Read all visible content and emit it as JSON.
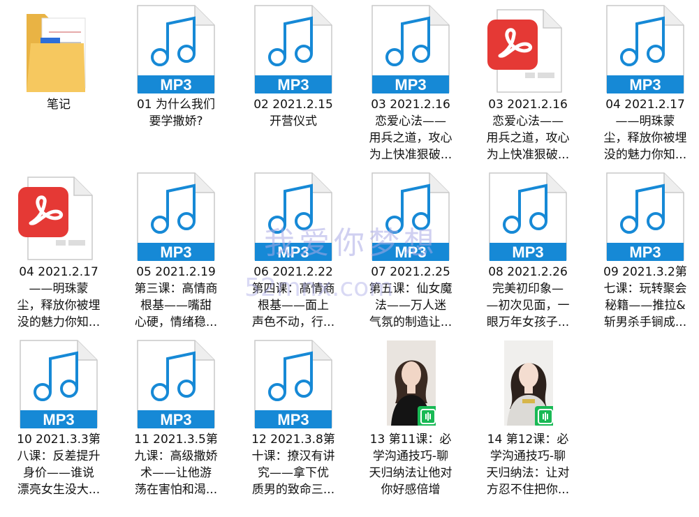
{
  "items": [
    {
      "type": "folder",
      "label": "笔记"
    },
    {
      "type": "mp3",
      "label": "01 为什么我们\n要学撒娇?"
    },
    {
      "type": "mp3",
      "label": "02 2021.2.15\n开营仪式"
    },
    {
      "type": "mp3",
      "label": "03 2021.2.16\n恋爱心法——\n用兵之道，攻心\n为上快准狠破..."
    },
    {
      "type": "pdf",
      "label": "03 2021.2.16\n恋爱心法——\n用兵之道，攻心\n为上快准狠破..."
    },
    {
      "type": "mp3",
      "label": "04 2021.2.17\n——明珠蒙\n尘，释放你被埋\n没的魅力你知..."
    },
    {
      "type": "pdf",
      "label": "04 2021.2.17\n——明珠蒙\n尘，释放你被埋\n没的魅力你知..."
    },
    {
      "type": "mp3",
      "label": "05 2021.2.19\n第三课：高情商\n根基——嘴甜\n心硬，情绪稳..."
    },
    {
      "type": "mp3",
      "label": "06 2021.2.22\n第四课：高情商\n根基——面上\n声色不动，行..."
    },
    {
      "type": "mp3",
      "label": "07 2021.2.25\n第五课：仙女魔\n法——万人迷\n气氛的制造让..."
    },
    {
      "type": "mp3",
      "label": "08 2021.2.26\n完美初印象—\n—初次见面，一\n眼万年女孩子..."
    },
    {
      "type": "mp3",
      "label": "09 2021.3.2第\n七课：玩转聚会\n秘籍——推拉&\n斩男杀手锏成..."
    },
    {
      "type": "mp3",
      "label": "10 2021.3.3第\n八课：反差提升\n身价——谁说\n漂亮女生没大..."
    },
    {
      "type": "mp3",
      "label": "11 2021.3.5第\n九课：高级撒娇\n术——让他游\n荡在害怕和渴..."
    },
    {
      "type": "mp3",
      "label": "12 2021.3.8第\n十课：撩汉有讲\n究——拿下优\n质男的致命三..."
    },
    {
      "type": "video",
      "label": "13 第11课：必\n学沟通技巧-聊\n天归纳法让他对\n你好感倍增"
    },
    {
      "type": "video",
      "label": "14 第12课：必\n学沟通技巧-聊\n天归纳法：让对\n方忍不住把你..."
    }
  ],
  "mp3_text": "MP3",
  "watermark": {
    "line1": "我爱你梦想",
    "line2": "52mnx.com"
  },
  "colors": {
    "mp3_blue": "#1689d6",
    "pdf_red": "#e53935",
    "folder": "#f6c85f",
    "badge_green": "#19b955"
  }
}
